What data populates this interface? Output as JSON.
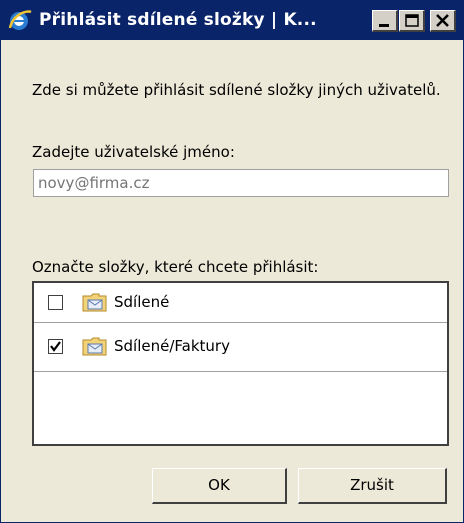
{
  "window": {
    "title": "Přihlásit sdílené složky | K...",
    "colors": {
      "title_bar": "#0a246a",
      "background": "#ece9d8"
    }
  },
  "titlebar_buttons": [
    "minimize-icon",
    "maximize-icon",
    "close-icon"
  ],
  "intro_text": "Zde si můžete přihlásit sdílené složky jiných uživatelů.",
  "username": {
    "label": "Zadejte uživatelské jméno:",
    "value": "",
    "placeholder": "novy@firma.cz"
  },
  "folders": {
    "label": "Označte složky, které chcete přihlásit:",
    "items": [
      {
        "name": "Sdílené",
        "checked": false,
        "icon": "mail-folder-icon"
      },
      {
        "name": "Sdílené/Faktury",
        "checked": true,
        "icon": "mail-folder-icon"
      }
    ]
  },
  "buttons": {
    "ok": "OK",
    "cancel": "Zrušit"
  }
}
